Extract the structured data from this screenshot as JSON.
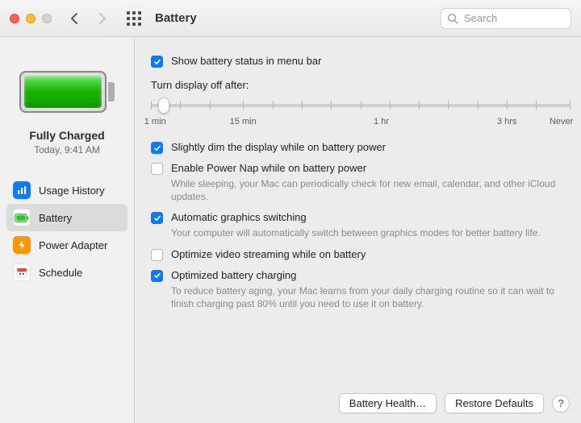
{
  "toolbar": {
    "title": "Battery",
    "search_placeholder": "Search"
  },
  "sidebar": {
    "status_line1": "Fully Charged",
    "status_line2": "Today, 9:41 AM",
    "items": [
      {
        "label": "Usage History"
      },
      {
        "label": "Battery"
      },
      {
        "label": "Power Adapter"
      },
      {
        "label": "Schedule"
      }
    ],
    "selected_index": 1
  },
  "content": {
    "show_status": {
      "checked": true,
      "label": "Show battery status in menu bar"
    },
    "slider_title": "Turn display off after:",
    "slider_labels": [
      "1 min",
      "15 min",
      "1 hr",
      "3 hrs",
      "Never"
    ],
    "dim_display": {
      "checked": true,
      "label": "Slightly dim the display while on battery power"
    },
    "power_nap": {
      "checked": false,
      "label": "Enable Power Nap while on battery power",
      "desc": "While sleeping, your Mac can periodically check for new email, calendar, and other iCloud updates."
    },
    "auto_graphics": {
      "checked": true,
      "label": "Automatic graphics switching",
      "desc": "Your computer will automatically switch between graphics modes for better battery life."
    },
    "optimize_video": {
      "checked": false,
      "label": "Optimize video streaming while on battery"
    },
    "optimized_charging": {
      "checked": true,
      "label": "Optimized battery charging",
      "desc": "To reduce battery aging, your Mac learns from your daily charging routine so it can wait to finish charging past 80% until you need to use it on battery."
    }
  },
  "footer": {
    "health_btn": "Battery Health…",
    "restore_btn": "Restore Defaults"
  }
}
